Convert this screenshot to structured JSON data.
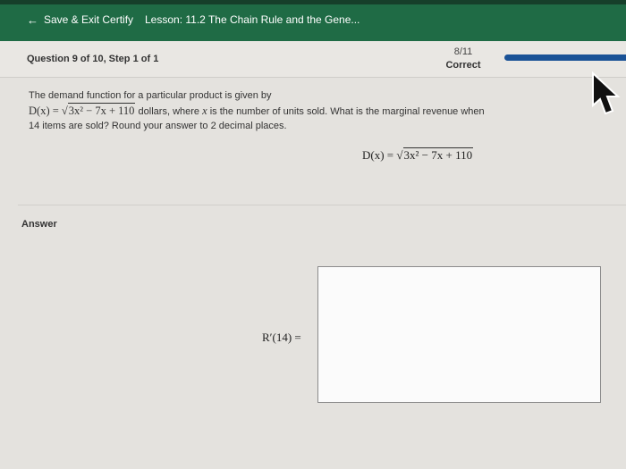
{
  "topbar": {
    "save_exit_label": "Save & Exit Certify",
    "lesson_title": "Lesson: 11.2 The Chain Rule and the Gene..."
  },
  "question_header": {
    "question_label": "Question 9 of 10, Step 1 of 1",
    "score": "8/11",
    "status": "Correct",
    "progress_color": "#1a5296"
  },
  "problem": {
    "intro": "The demand function for a particular product is given by",
    "equation_lhs": "D(x) =",
    "radicand": "3x² − 7x + 110",
    "after_equation": "dollars, where",
    "variable": "x",
    "after_variable": "is the number of units sold. What is the marginal revenue when",
    "line3": "14 items are sold? Round your answer to 2 decimal places.",
    "display_lhs": "D(x) =",
    "display_radicand": "3x² − 7x + 110"
  },
  "answer": {
    "label": "Answer",
    "lhs": "R′(14) =",
    "value": ""
  },
  "colors": {
    "topbar": "#1f6b45",
    "background": "#e4e2de"
  }
}
